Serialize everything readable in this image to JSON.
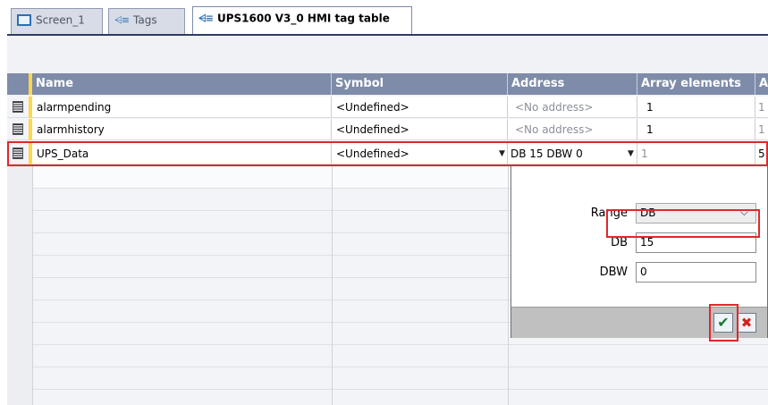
{
  "tabs": [
    {
      "label": "Screen_1",
      "icon": "screen-icon"
    },
    {
      "label": "Tags",
      "icon": "tags-icon"
    },
    {
      "label": "UPS1600 V3_0 HMI tag table",
      "icon": "tags-icon",
      "active": true
    }
  ],
  "table": {
    "columns": [
      "Name",
      "Symbol",
      "Address",
      "Array elements",
      "A"
    ],
    "rows": [
      {
        "name": "alarmpending",
        "symbol": "<Undefined>",
        "address": "<No address>",
        "array_elements": "1",
        "extra": "1"
      },
      {
        "name": "alarmhistory",
        "symbol": "<Undefined>",
        "address": "<No address>",
        "array_elements": "1",
        "extra": "1"
      },
      {
        "name": "UPS_Data",
        "symbol": "<Undefined>",
        "address": "DB 15 DBW 0",
        "array_elements": "1",
        "extra": "5"
      }
    ]
  },
  "address_popup": {
    "range_label": "Range",
    "range_value": "DB",
    "db_label": "DB",
    "db_value": "15",
    "dbw_label": "DBW",
    "dbw_value": "0",
    "ok_icon": "checkmark-icon",
    "cancel_icon": "close-icon"
  },
  "colors": {
    "header": "#7e8ca9",
    "highlight": "#e0282d",
    "row_edge": "#ffd74a"
  }
}
